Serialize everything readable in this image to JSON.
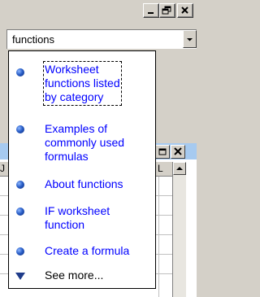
{
  "window_controls": {
    "minimize": "minimize-icon",
    "restore": "restore-icon",
    "close": "close-icon"
  },
  "search": {
    "value": "functions",
    "dropdown_icon": "chevron-down-icon"
  },
  "results": [
    {
      "label": "Worksheet\nfunctions listed\nby category",
      "icon": "bullet-icon",
      "focused": true
    },
    {
      "label": "Examples of\ncommonly used\nformulas",
      "icon": "bullet-icon"
    },
    {
      "label": "About functions",
      "icon": "bullet-icon"
    },
    {
      "label": "IF worksheet\nfunction",
      "icon": "bullet-icon"
    },
    {
      "label": "Create a formula",
      "icon": "bullet-icon"
    }
  ],
  "see_more": {
    "label": "See more...",
    "icon": "triangle-down-icon"
  },
  "background_sheet": {
    "column_left": "J",
    "column_right": "L"
  },
  "colors": {
    "link": "#0000ff",
    "face": "#d4d0c8",
    "bullet": "#2a5fc8"
  }
}
